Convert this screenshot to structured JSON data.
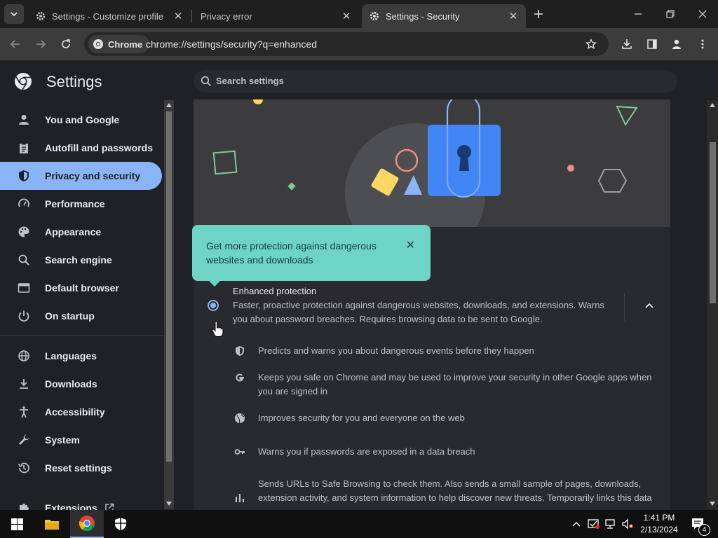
{
  "tabs": [
    {
      "label": "Settings - Customize profile",
      "icon": "gear-icon",
      "close": "✕"
    },
    {
      "label": "Privacy error",
      "icon": "",
      "close": "✕"
    },
    {
      "label": "Settings - Security",
      "icon": "gear-icon",
      "close": "✕"
    }
  ],
  "toolbar": {
    "chip_label": "Chrome",
    "url": "chrome://settings/security?q=enhanced"
  },
  "settings": {
    "title": "Settings",
    "search_placeholder": "Search settings"
  },
  "sidebar": {
    "items": [
      {
        "label": "You and Google",
        "icon": "person-icon"
      },
      {
        "label": "Autofill and passwords",
        "icon": "clipboard-icon"
      },
      {
        "label": "Privacy and security",
        "icon": "shield-icon",
        "active": true
      },
      {
        "label": "Performance",
        "icon": "speedometer-icon"
      },
      {
        "label": "Appearance",
        "icon": "palette-icon"
      },
      {
        "label": "Search engine",
        "icon": "search-icon"
      },
      {
        "label": "Default browser",
        "icon": "browser-icon"
      },
      {
        "label": "On startup",
        "icon": "power-icon"
      },
      {
        "label": "Languages",
        "icon": "globe-icon"
      },
      {
        "label": "Downloads",
        "icon": "download-icon"
      },
      {
        "label": "Accessibility",
        "icon": "accessibility-icon"
      },
      {
        "label": "System",
        "icon": "wrench-icon"
      },
      {
        "label": "Reset settings",
        "icon": "history-icon"
      },
      {
        "label": "Extensions",
        "icon": "puzzle-icon"
      }
    ]
  },
  "tooltip": {
    "text": "Get more protection against dangerous websites and downloads",
    "close": "✕"
  },
  "enhanced": {
    "title": "Enhanced protection",
    "description": "Faster, proactive protection against dangerous websites, downloads, and extensions. Warns you about password breaches. Requires browsing data to be sent to Google.",
    "benefits": [
      {
        "icon": "shield-icon",
        "text": "Predicts and warns you about dangerous events before they happen"
      },
      {
        "icon": "google-g-icon",
        "text": "Keeps you safe on Chrome and may be used to improve your security in other Google apps when you are signed in"
      },
      {
        "icon": "globe-icon",
        "text": "Improves security for you and everyone on the web"
      },
      {
        "icon": "key-icon",
        "text": "Warns you if passwords are exposed in a data breach"
      },
      {
        "icon": "bar-chart-icon",
        "text": "Sends URLs to Safe Browsing to check them. Also sends a small sample of pages, downloads, extension activity, and system information to help discover new threats. Temporarily links this data"
      }
    ]
  },
  "taskbar": {
    "time": "1:41 PM",
    "date": "2/13/2024",
    "notif_count": "4"
  },
  "colors": {
    "accent": "#8ab4f8",
    "tooltip": "#6ed4c6",
    "lock": "#4285f4"
  }
}
